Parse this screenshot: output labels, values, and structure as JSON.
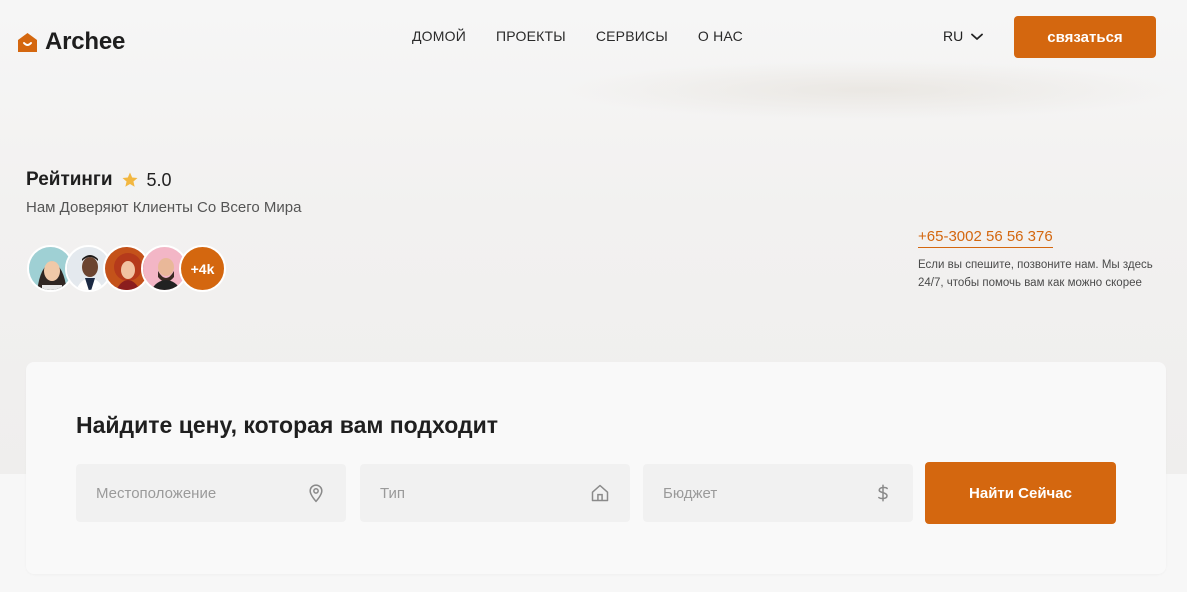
{
  "brand": {
    "name": "Archee",
    "accent": "#d4670f"
  },
  "nav": {
    "items": [
      {
        "label": "ДОМОЙ"
      },
      {
        "label": "ПРОЕКТЫ"
      },
      {
        "label": "СЕРВИСЫ"
      },
      {
        "label": "О НАС"
      }
    ]
  },
  "header": {
    "language": "RU",
    "contact_label": "связаться"
  },
  "ratings": {
    "title": "Рейтинги",
    "value": "5.0",
    "subtitle": "Нам Доверяют Клиенты Со Всего Мира",
    "more_count": "+4k"
  },
  "contact": {
    "phone": "+65-3002 56 56 376",
    "note": "Если вы спешите, позвоните нам. Мы здесь 24/7, чтобы помочь вам как можно скорее"
  },
  "search": {
    "title": "Найдите цену, которая вам подходит",
    "location_placeholder": "Местоположение",
    "type_placeholder": "Тип",
    "budget_placeholder": "Бюджет",
    "button_label": "Найти Сейчас"
  }
}
